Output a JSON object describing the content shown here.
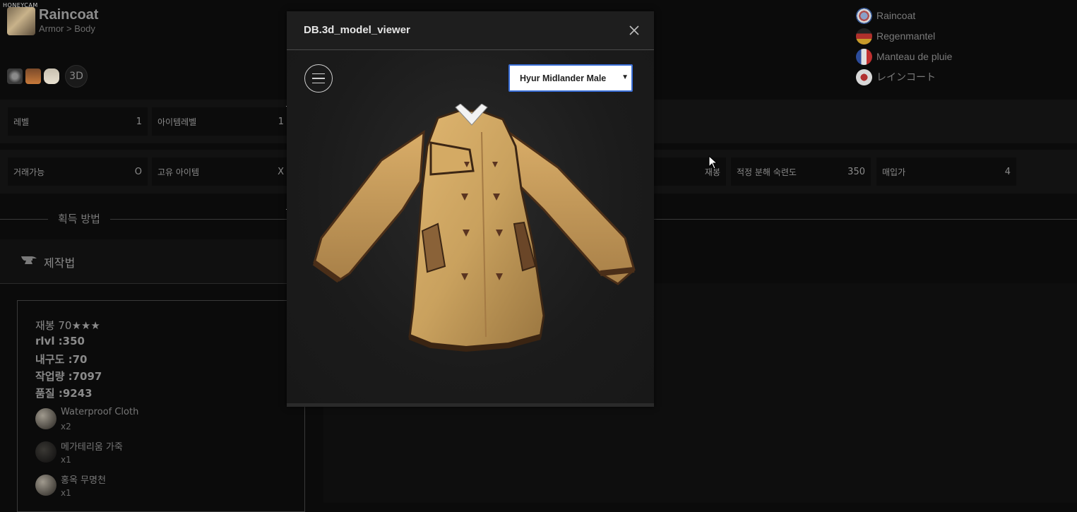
{
  "watermark": "HONEYCAM",
  "item": {
    "name": "Raincoat",
    "category": "Armor > Body",
    "btn_3d": "3D"
  },
  "languages": [
    {
      "label": "Raincoat",
      "flag": "en"
    },
    {
      "label": "Regenmantel",
      "flag": "de"
    },
    {
      "label": "Manteau de pluie",
      "flag": "fr"
    },
    {
      "label": "レインコート",
      "flag": "jp"
    }
  ],
  "stats_row1": [
    {
      "label": "레벨",
      "value": "1"
    },
    {
      "label": "아이템레벨",
      "value": "1"
    }
  ],
  "stats_row2_left": [
    {
      "label": "거래가능",
      "value": "O"
    },
    {
      "label": "고유 아이템",
      "value": "X"
    }
  ],
  "stats_row2_right": [
    {
      "label": "재봉",
      "value": ""
    },
    {
      "label": "적정 분해 숙련도",
      "value": "350"
    },
    {
      "label": "매입가",
      "value": "4"
    }
  ],
  "section": {
    "obtain_label": "획득 방법"
  },
  "craft": {
    "title": "제작법",
    "stats": [
      "재봉 70★★★",
      "rlvl :350",
      "내구도 :70",
      "작업량 :7097",
      "품질 :9243"
    ],
    "ingredients": [
      {
        "name": "Waterproof Cloth",
        "qty": "x2"
      },
      {
        "name": "메가테리움 가죽",
        "qty": "x1"
      },
      {
        "name": "홍옥 무명천",
        "qty": "x1"
      }
    ]
  },
  "modal": {
    "title": "DB.3d_model_viewer",
    "select_value": "Hyur Midlander Male",
    "coat_color": "#c9a15e"
  }
}
